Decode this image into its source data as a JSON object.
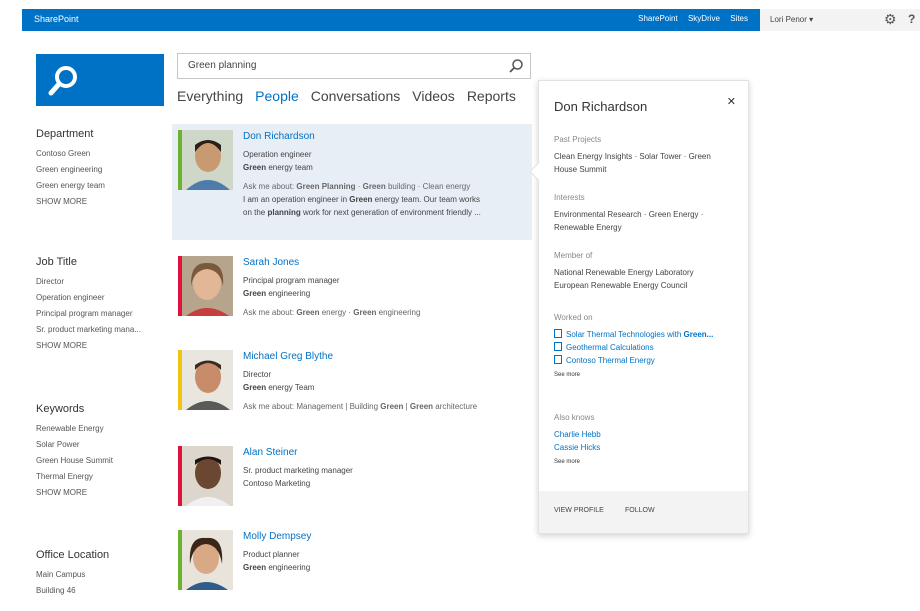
{
  "topbar": {
    "brand": "SharePoint",
    "links": [
      "SharePoint",
      "SkyDrive",
      "Sites"
    ]
  },
  "userbar": {
    "user": "Lori Penor ▾"
  },
  "search": {
    "query": "Green planning"
  },
  "verticals": [
    "Everything",
    "People",
    "Conversations",
    "Videos",
    "Reports"
  ],
  "refiners": [
    {
      "title": "Department",
      "items": [
        "Contoso Green",
        "Green engineering",
        "Green energy team",
        "SHOW MORE"
      ]
    },
    {
      "title": "Job Title",
      "items": [
        "Director",
        "Operation engineer",
        "Principal program manager",
        "Sr. product marketing mana...",
        "SHOW MORE"
      ]
    },
    {
      "title": "Keywords",
      "items": [
        "Renewable Energy",
        "Solar Power",
        "Green House Summit",
        "Thermal Energy",
        "SHOW MORE"
      ]
    },
    {
      "title": "Office Location",
      "items": [
        "Main Campus",
        "Building 46"
      ]
    }
  ],
  "results": [
    {
      "name": "Don Richardson",
      "title": "Operation engineer",
      "dept_bold": "Green",
      "dept_rest": " energy team",
      "about_prefix": "Ask me about: ",
      "about_b1": "Green Planning",
      "about_m1": " · ",
      "about_b2": "Green",
      "about_m2": " building · Clean energy",
      "desc1_pre": "I am an operation engineer in ",
      "desc1_b": "Green",
      "desc1_post": " energy team. Our team works",
      "desc2_pre": "on the ",
      "desc2_b": "planning",
      "desc2_post": " work for next generation of environment friendly ..."
    },
    {
      "name": "Sarah Jones",
      "title": "Principal program manager",
      "dept_bold": "Green",
      "dept_rest": " engineering",
      "about_prefix": "Ask me about: ",
      "about_b1": "Green",
      "about_m1": " energy · ",
      "about_b2": "Green",
      "about_m2": " engineering"
    },
    {
      "name": "Michael Greg Blythe",
      "title": "Director",
      "dept_bold": "Green",
      "dept_rest": " energy Team",
      "about_prefix": "Ask me about: Management | Building ",
      "about_b1": "Green",
      "about_m1": " | ",
      "about_b2": "Green",
      "about_m2": " architecture"
    },
    {
      "name": "Alan Steiner",
      "title": "Sr. product marketing manager",
      "dept_plain": "Contoso Marketing"
    },
    {
      "name": "Molly Dempsey",
      "title": "Product planner",
      "dept_bold": "Green",
      "dept_rest": " engineering"
    }
  ],
  "colors": {
    "accent": "#0072c6",
    "bar_green": "#6bb22f",
    "bar_red": "#e0113d",
    "bar_yellow": "#f1c40f"
  },
  "card": {
    "name": "Don Richardson",
    "past_projects_label": "Past Projects",
    "past_projects": [
      "Clean Energy Insights · Solar Tower · Green",
      "House Summit"
    ],
    "interests_label": "Interests",
    "interests": [
      "Environmental Research · Green Energy ·",
      "Renewable Energy"
    ],
    "member_label": "Member of",
    "member": [
      "National Renewable Energy Laboratory",
      "European Renewable Energy Council"
    ],
    "worked_label": "Worked on",
    "worked_on": [
      {
        "pre": "Solar Thermal Technologies with ",
        "b": "Green..."
      },
      {
        "pre": "Geothermal Calculations",
        "b": ""
      },
      {
        "pre": "Contoso Thermal Energy",
        "b": ""
      }
    ],
    "see_more": "See more",
    "also_knows_label": "Also knows",
    "also_knows": [
      "Charlie Hebb",
      "Cassie Hicks"
    ],
    "see_more2": "See more",
    "view_profile": "VIEW PROFILE",
    "follow": "FOLLOW"
  }
}
